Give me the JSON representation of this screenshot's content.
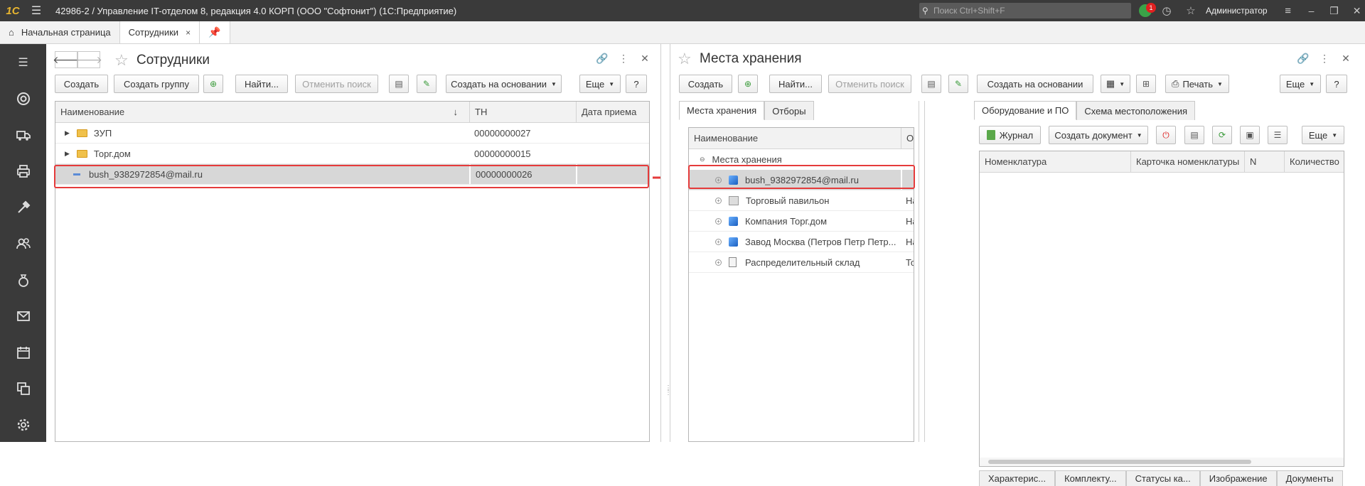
{
  "window": {
    "title": "42986-2 / Управление IT-отделом 8, редакция 4.0 КОРП (ООО \"Софтонит\")  (1С:Предприятие)",
    "logo": "1С",
    "search_placeholder": "Поиск Ctrl+Shift+F",
    "notifications_count": "1",
    "user": "Администратор"
  },
  "tabs": [
    {
      "label": "Начальная страница",
      "icon": "home-icon"
    },
    {
      "label": "Сотрудники",
      "close": "×"
    },
    {
      "label": "",
      "icon": "pin-icon"
    }
  ],
  "sidebar": [
    "menu-icon",
    "lifebuoy-icon",
    "truck-icon",
    "printer-icon",
    "tools-icon",
    "users-icon",
    "moneybag-icon",
    "mail-icon",
    "calendar-icon",
    "copy-icon",
    "gear-icon"
  ],
  "employees": {
    "title": "Сотрудники",
    "buttons": {
      "create": "Создать",
      "create_group": "Создать группу",
      "find": "Найти...",
      "cancel_search": "Отменить поиск",
      "create_based_on": "Создать на основании",
      "more": "Еще",
      "help": "?"
    },
    "columns": [
      "Наименование",
      "ТН",
      "Дата приема"
    ],
    "sort_indicator": "↓",
    "rows": [
      {
        "name": "ЗУП",
        "tn": "00000000027",
        "date": "",
        "kind": "folder"
      },
      {
        "name": "Торг.дом",
        "tn": "00000000015",
        "date": "",
        "kind": "folder"
      },
      {
        "name": "bush_9382972854@mail.ru",
        "tn": "00000000026",
        "date": "",
        "kind": "item",
        "selected": true
      }
    ]
  },
  "storage": {
    "title": "Места хранения",
    "buttons": {
      "create": "Создать",
      "find": "Найти...",
      "cancel_search": "Отменить поиск",
      "create_based_on": "Создать на основании",
      "print": "Печать",
      "more": "Еще",
      "help": "?"
    },
    "tabs": [
      "Места хранения",
      "Отборы"
    ],
    "columns": [
      "Наименование",
      "Органи..."
    ],
    "root": "Места хранения",
    "rows": [
      {
        "name": "bush_9382972854@mail.ru",
        "org": "",
        "icon": "cube-icon",
        "selected": true
      },
      {
        "name": "Торговый павильон",
        "org": "Наша фи...",
        "icon": "building-icon"
      },
      {
        "name": "Компания Торг.дом",
        "org": "Наша фи...",
        "icon": "cube-icon"
      },
      {
        "name": "Завод Москва (Петров Петр Петр...",
        "org": "Наша фи...",
        "icon": "cube-icon"
      },
      {
        "name": "Распределительный склад",
        "org": "Торговый ...",
        "icon": "document-icon"
      }
    ],
    "right_tabs": [
      "Оборудование и ПО",
      "Схема местоположения"
    ],
    "right_buttons": {
      "journal": "Журнал",
      "create_doc": "Создать документ",
      "more": "Еще"
    },
    "right_columns": [
      "Номенклатура",
      "Карточка номенклатуры",
      "N",
      "Количество"
    ],
    "bottom_tabs": [
      "Характерис...",
      "Комплекту...",
      "Статусы ка...",
      "Изображение",
      "Документы"
    ]
  },
  "colors": {
    "highlight": "#e53b3b",
    "titlebar": "#3a3a3a"
  }
}
